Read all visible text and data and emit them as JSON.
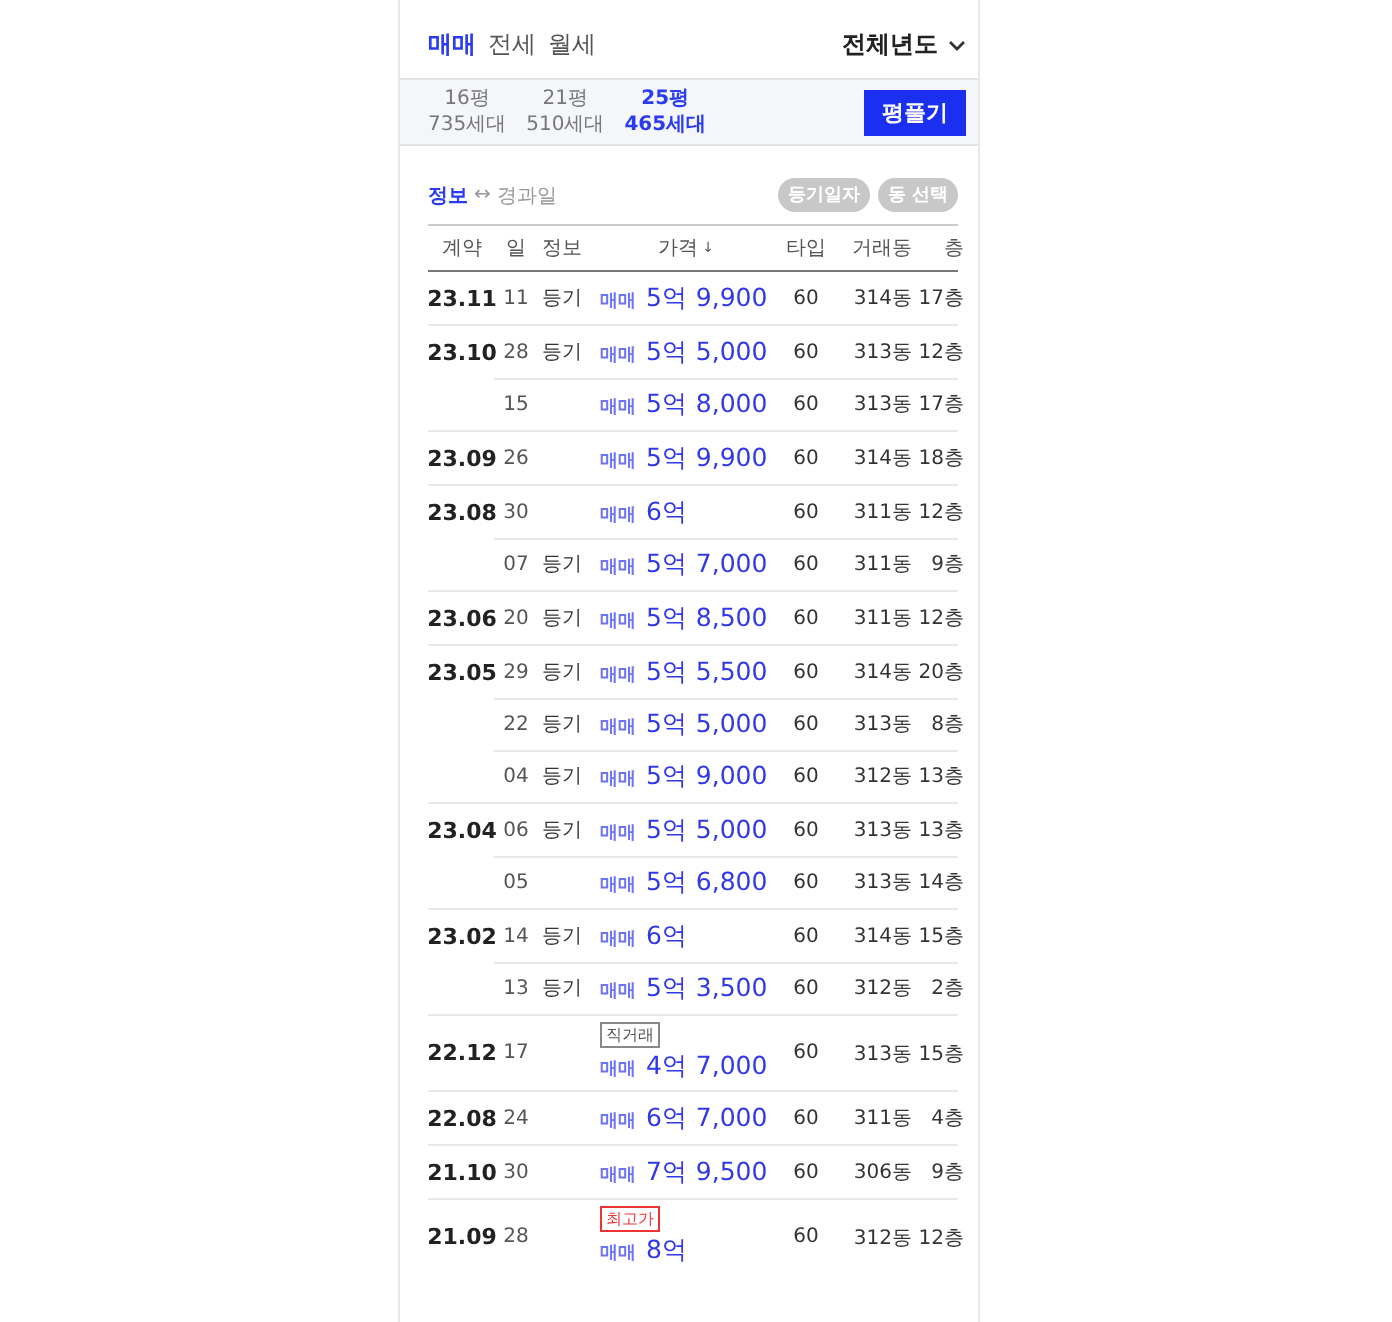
{
  "tabs": [
    {
      "label": "매매",
      "selected": true
    },
    {
      "label": "전세",
      "selected": false
    },
    {
      "label": "월세",
      "selected": false
    }
  ],
  "year_filter": {
    "label": "전체년도"
  },
  "sizes": [
    {
      "area": "16평",
      "households": "735세대",
      "selected": false
    },
    {
      "area": "21평",
      "households": "510세대",
      "selected": false
    },
    {
      "area": "25평",
      "households": "465세대",
      "selected": true
    }
  ],
  "size_button": "평풀기",
  "view_toggle": [
    {
      "label": "정보",
      "selected": true
    },
    {
      "label": "경과일",
      "selected": false
    }
  ],
  "toggle_arrow": "↔",
  "chips": [
    "등기일자",
    "동 선택"
  ],
  "table": {
    "columns": [
      "계약",
      "일",
      "정보",
      "가격",
      "타입",
      "거래동",
      "층"
    ],
    "sort_arrow": "↓",
    "rows": [
      {
        "month": "23.11",
        "day": "11",
        "info": "등기",
        "deal": "매매",
        "price": "5억 9,900",
        "type": "60",
        "building": "314동",
        "floor": "17층"
      },
      {
        "month": "23.10",
        "day": "28",
        "info": "등기",
        "deal": "매매",
        "price": "5억 5,000",
        "type": "60",
        "building": "313동",
        "floor": "12층"
      },
      {
        "day": "15",
        "deal": "매매",
        "price": "5억 8,000",
        "type": "60",
        "building": "313동",
        "floor": "17층"
      },
      {
        "month": "23.09",
        "day": "26",
        "deal": "매매",
        "price": "5억 9,900",
        "type": "60",
        "building": "314동",
        "floor": "18층"
      },
      {
        "month": "23.08",
        "day": "30",
        "deal": "매매",
        "price": "6억",
        "type": "60",
        "building": "311동",
        "floor": "12층"
      },
      {
        "day": "07",
        "info": "등기",
        "deal": "매매",
        "price": "5억 7,000",
        "type": "60",
        "building": "311동",
        "floor": "9층"
      },
      {
        "month": "23.06",
        "day": "20",
        "info": "등기",
        "deal": "매매",
        "price": "5억 8,500",
        "type": "60",
        "building": "311동",
        "floor": "12층"
      },
      {
        "month": "23.05",
        "day": "29",
        "info": "등기",
        "deal": "매매",
        "price": "5억 5,500",
        "type": "60",
        "building": "314동",
        "floor": "20층"
      },
      {
        "day": "22",
        "info": "등기",
        "deal": "매매",
        "price": "5억 5,000",
        "type": "60",
        "building": "313동",
        "floor": "8층"
      },
      {
        "day": "04",
        "info": "등기",
        "deal": "매매",
        "price": "5억 9,000",
        "type": "60",
        "building": "312동",
        "floor": "13층"
      },
      {
        "month": "23.04",
        "day": "06",
        "info": "등기",
        "deal": "매매",
        "price": "5억 5,000",
        "type": "60",
        "building": "313동",
        "floor": "13층"
      },
      {
        "day": "05",
        "deal": "매매",
        "price": "5억 6,800",
        "type": "60",
        "building": "313동",
        "floor": "14층"
      },
      {
        "month": "23.02",
        "day": "14",
        "info": "등기",
        "deal": "매매",
        "price": "6억",
        "type": "60",
        "building": "314동",
        "floor": "15층"
      },
      {
        "day": "13",
        "info": "등기",
        "deal": "매매",
        "price": "5억 3,500",
        "type": "60",
        "building": "312동",
        "floor": "2층"
      },
      {
        "month": "22.12",
        "day": "17",
        "tag": {
          "text": "직거래",
          "kind": "direct"
        },
        "deal": "매매",
        "price": "4억 7,000",
        "type": "60",
        "building": "313동",
        "floor": "15층"
      },
      {
        "month": "22.08",
        "day": "24",
        "deal": "매매",
        "price": "6억 7,000",
        "type": "60",
        "building": "311동",
        "floor": "4층"
      },
      {
        "month": "21.10",
        "day": "30",
        "deal": "매매",
        "price": "7억 9,500",
        "type": "60",
        "building": "306동",
        "floor": "9층"
      },
      {
        "month": "21.09",
        "day": "28",
        "tag": {
          "text": "최고가",
          "kind": "highest"
        },
        "deal": "매매",
        "price": "8억",
        "type": "60",
        "building": "312동",
        "floor": "12층"
      }
    ]
  }
}
